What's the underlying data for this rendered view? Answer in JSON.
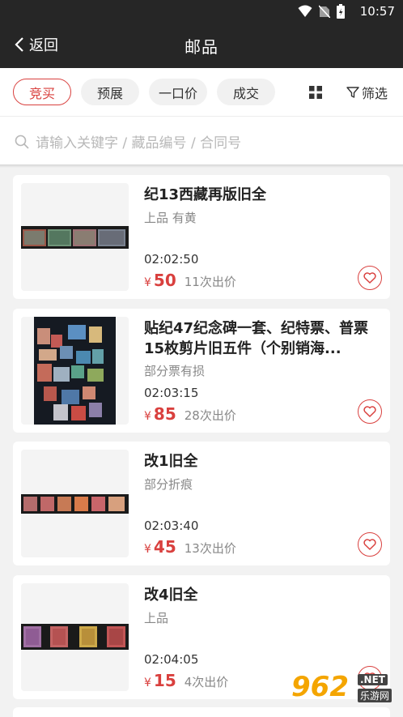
{
  "status_bar": {
    "time": "10:57"
  },
  "app_bar": {
    "back_label": "返回",
    "title": "邮品"
  },
  "tabs": [
    {
      "label": "竞买",
      "active": true
    },
    {
      "label": "预展",
      "active": false
    },
    {
      "label": "一口价",
      "active": false
    },
    {
      "label": "成交",
      "active": false
    }
  ],
  "filter_label": "筛选",
  "search": {
    "placeholder": "请输入关键字 / 藏品编号 / 合同号"
  },
  "items": [
    {
      "title": "纪13西藏再版旧全",
      "condition": "上品 有黄",
      "time": "02:02:50",
      "currency": "¥",
      "price": "50",
      "bids": "11次出价"
    },
    {
      "title": "贴纪47纪念碑一套、纪特票、普票15枚剪片旧五件（个别销海...",
      "condition": "部分票有损",
      "time": "02:03:15",
      "currency": "¥",
      "price": "85",
      "bids": "28次出价"
    },
    {
      "title": "改1旧全",
      "condition": "部分折痕",
      "time": "02:03:40",
      "currency": "¥",
      "price": "45",
      "bids": "13次出价"
    },
    {
      "title": "改4旧全",
      "condition": "上品",
      "time": "02:04:05",
      "currency": "¥",
      "price": "15",
      "bids": "4次出价"
    }
  ],
  "watermark": {
    "logo": "962",
    "net": ".NET",
    "site": "乐游网"
  },
  "colors": {
    "accent": "#d9403e",
    "header": "#262626",
    "background": "#f2f2f2"
  }
}
